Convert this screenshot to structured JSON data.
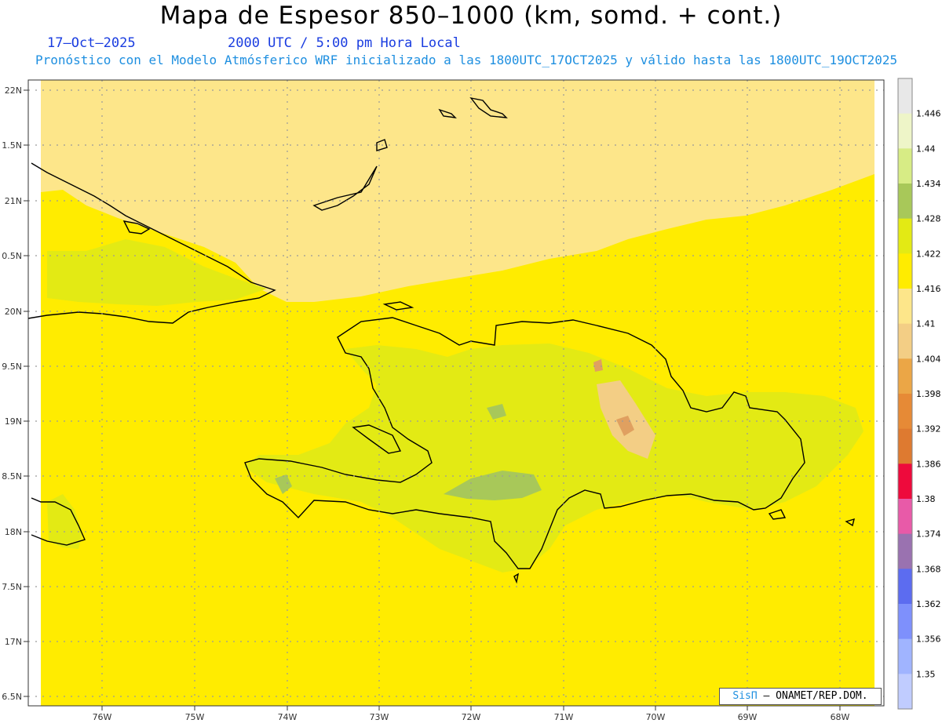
{
  "header": {
    "title": "Mapa de Espesor 850–1000 (km, somd. + cont.)",
    "date": "17–Oct–2025",
    "utc_time": "2000 UTC / 5:00 pm Hora Local",
    "subtitle": "Pronóstico con el Modelo Atmósferico WRF inicializado a las 1800UTC_17OCT2025 y válido hasta las  1800UTC_19OCT2025"
  },
  "map": {
    "lat_labels": [
      "22N",
      "1.5N",
      "21N",
      "0.5N",
      "20N",
      "9.5N",
      "19N",
      "8.5N",
      "18N",
      "7.5N",
      "17N",
      "6.5N"
    ],
    "lon_labels": [
      "76W",
      "75W",
      "74W",
      "73W",
      "72W",
      "71W",
      "70W",
      "69W",
      "68W"
    ],
    "colors": {
      "ocean_fill": "#ffec00",
      "north_band": "#fde68a",
      "island_low": "#e3ea14",
      "green_mid": "#a8c859",
      "dark_green": "#8fb04a",
      "orange_patch": "#f3ce85",
      "brown_patch": "#e0a060",
      "coastline": "#000000",
      "grid": "#9a9a9a"
    }
  },
  "colorbar": {
    "labels": [
      "1.446",
      "1.44",
      "1.434",
      "1.428",
      "1.422",
      "1.416",
      "1.41",
      "1.404",
      "1.398",
      "1.392",
      "1.386",
      "1.38",
      "1.374",
      "1.368",
      "1.362",
      "1.356",
      "1.35"
    ],
    "colors": [
      "#e8e8e8",
      "#eef5c8",
      "#d7ec85",
      "#a8c859",
      "#e3ea14",
      "#ffec00",
      "#fde68a",
      "#f3ce85",
      "#eba646",
      "#e68a36",
      "#de7a30",
      "#ee0a3c",
      "#e85aa8",
      "#9a72b0",
      "#5c6cf0",
      "#7e90fc",
      "#a0b4ff",
      "#c0ccff"
    ]
  },
  "credit": {
    "brand": "SisΠ",
    "text": "– ONAMET/REP.DOM."
  }
}
